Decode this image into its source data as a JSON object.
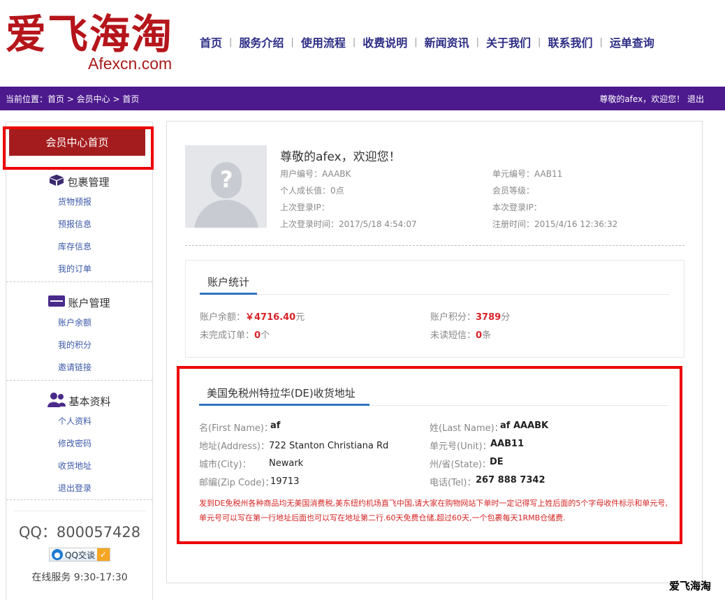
{
  "logo": {
    "cn": "爱飞海淘",
    "en": "Afexcn.com"
  },
  "nav": [
    "首页",
    "服务介绍",
    "使用流程",
    "收费说明",
    "新闻资讯",
    "关于我们",
    "联系我们",
    "运单查询"
  ],
  "breadcrumb": "当前位置：首页 > 会员中心 > 首页",
  "welcome": "尊敬的afex，欢迎您！ 退出",
  "sidebar": {
    "home": "会员中心首页",
    "groups": [
      {
        "icon": "package-icon",
        "title": "包裹管理",
        "items": [
          "货物预报",
          "预报信息",
          "库存信息",
          "我的订单"
        ]
      },
      {
        "icon": "card-icon",
        "title": "账户管理",
        "items": [
          "账户余额",
          "我的积分",
          "邀请链接"
        ]
      },
      {
        "icon": "users-icon",
        "title": "基本资料",
        "items": [
          "个人资料",
          "修改密码",
          "收货地址",
          "退出登录"
        ]
      }
    ],
    "qq": {
      "number": "QQ：800057428",
      "button": "QQ交谈",
      "hours": "在线服务 9:30-17:30"
    }
  },
  "profile": {
    "greeting": "尊敬的afex，欢迎您！",
    "left": [
      "用户编号：AAABK",
      "个人成长值：0点",
      "上次登录IP：",
      "上次登录时间：2017/5/18 4:54:07"
    ],
    "right": [
      "单元编号：AAB11",
      "会员等级：",
      "本次登录IP：",
      "注册时间：2015/4/16 12:36:32"
    ]
  },
  "account": {
    "title": "账户统计",
    "balance_label": "账户余额：",
    "balance_value": "￥4716.40",
    "balance_unit": "元",
    "points_label": "账户积分：",
    "points_value": "3789",
    "points_unit": "分",
    "orders_label": "未完成订单：",
    "orders_value": "0",
    "orders_unit": "个",
    "sms_label": "未读短信：",
    "sms_value": "0",
    "sms_unit": "条"
  },
  "address": {
    "title": "美国免税州特拉华(DE)收货地址",
    "first_name_label": "名(First Name)：",
    "first_name": "af",
    "last_name_label": "姓(Last Name)：",
    "last_name": "af AAABK",
    "address_label": "地址(Address)：",
    "address": "722 Stanton Christiana Rd",
    "unit_label": "单元号(Unit)：",
    "unit": "AAB11",
    "city_label": "城市(City)：",
    "city": "Newark",
    "state_label": "州/省(State)：",
    "state": "DE",
    "zip_label": "邮编(Zip Code)：",
    "zip": "19713",
    "tel_label": "电话(Tel)：",
    "tel": "267 888 7342",
    "notice": "发到DE免税州各种商品均无美国消费税,美东纽约机场直飞中国,请大家在购物网站下单时一定记得写上姓后面的5个字母收件标示和单元号,单元号可以写在第一行地址后面也可以写在地址第二行.60天免费仓储,超过60天,一个包裹每天1RMB仓储费."
  },
  "watermark": "爱飞海淘"
}
